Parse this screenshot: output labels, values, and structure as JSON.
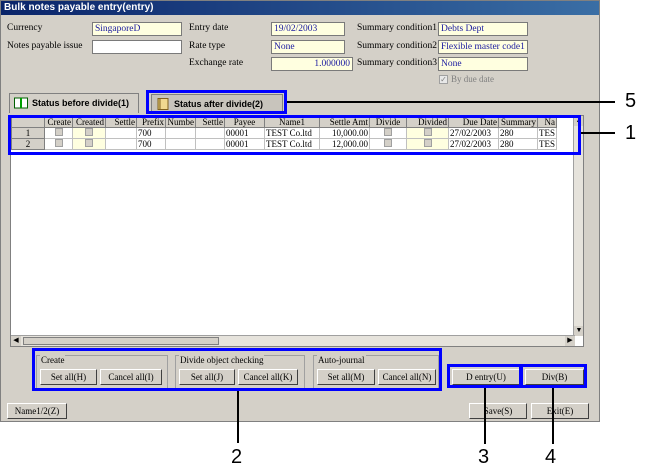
{
  "window": {
    "title": "Bulk notes payable entry(entry)"
  },
  "header": {
    "currency_label": "Currency",
    "currency_value": "SingaporeD",
    "notes_payable_issue_label": "Notes payable issue",
    "notes_payable_issue_value": "",
    "entry_date_label": "Entry date",
    "entry_date_value": "19/02/2003",
    "rate_type_label": "Rate type",
    "rate_type_value": "None",
    "exchange_rate_label": "Exchange rate",
    "exchange_rate_value": "1.000000",
    "summary1_label": "Summary condition1",
    "summary1_value": "Debts Dept",
    "summary2_label": "Summary condition2",
    "summary2_value": "Flexible master code1",
    "summary3_label": "Summary condition3",
    "summary3_value": "None",
    "by_due_date_label": "By due date"
  },
  "tabs": [
    {
      "label": "Status before divide(1)"
    },
    {
      "label": "Status after divide(2)"
    }
  ],
  "grid": {
    "columns": [
      "",
      "Create",
      "Created",
      "Settle",
      "Prefix",
      "Numbe",
      "Settle",
      "Payee",
      "Name1",
      "Settle Amt",
      "Divide",
      "Divided",
      "Due Date",
      "Summary",
      "Na"
    ],
    "rows": [
      {
        "num": "1",
        "prefix": "700",
        "payee": "00001",
        "name1": "TEST Co.ltd",
        "amt": "10,000.00",
        "due": "27/02/2003",
        "summary": "280",
        "na": "TES"
      },
      {
        "num": "2",
        "prefix": "700",
        "payee": "00001",
        "name1": "TEST Co.ltd",
        "amt": "12,000.00",
        "due": "27/02/2003",
        "summary": "280",
        "na": "TES"
      }
    ]
  },
  "groups": {
    "create": {
      "title": "Create",
      "set_all": "Set all(H)",
      "cancel_all": "Cancel all(I)"
    },
    "divide": {
      "title": "Divide object checking",
      "set_all": "Set all(J)",
      "cancel_all": "Cancel all(K)"
    },
    "auto": {
      "title": "Auto-journal",
      "set_all": "Set all(M)",
      "cancel_all": "Cancel all(N)"
    }
  },
  "buttons": {
    "d_entry": "D entry(U)",
    "div": "Div(B)",
    "name_toggle": "Name1/2(Z)",
    "save": "Save(S)",
    "exit": "Exit(E)"
  },
  "callouts": {
    "n1": "1",
    "n2": "2",
    "n3": "3",
    "n4": "4",
    "n5": "5"
  },
  "colors": {
    "highlight": "#0000ff",
    "field_bg": "#ffffe0",
    "field_text": "#1a1aa0"
  }
}
